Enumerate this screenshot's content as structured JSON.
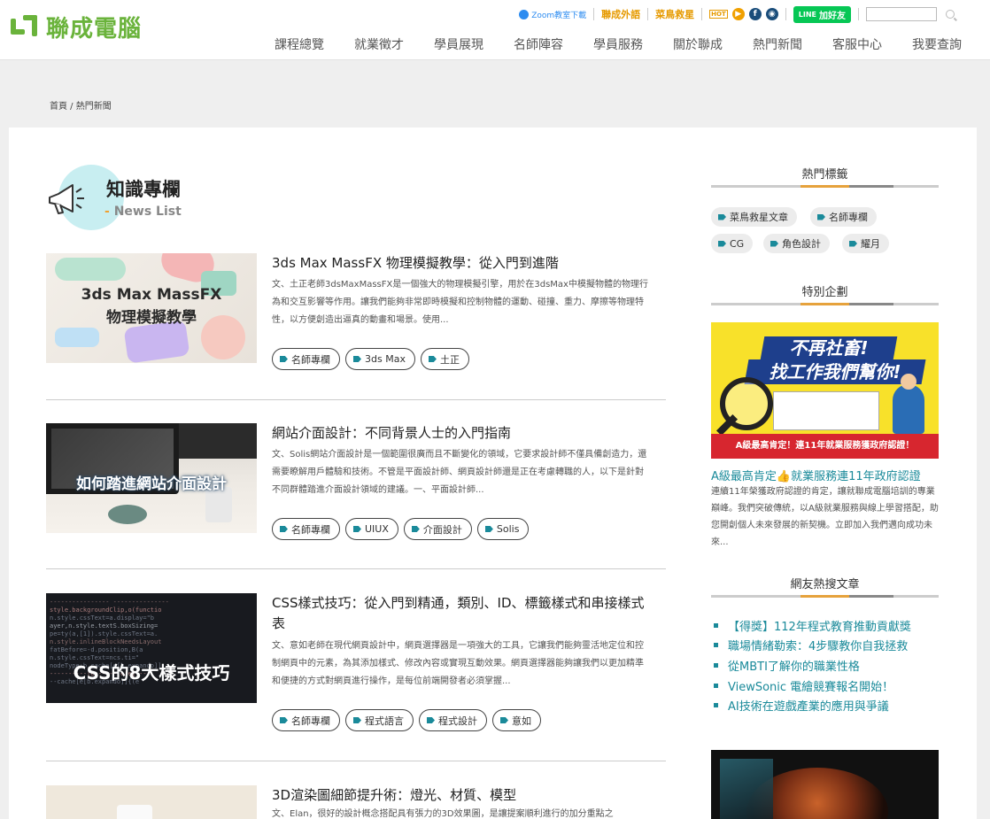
{
  "header": {
    "logo_text": "聯成電腦",
    "topbar": {
      "zoom": "Zoom教室下載",
      "lang": "聯成外語",
      "rescue": "菜鳥救星",
      "hot": "HOT",
      "line": "加好友",
      "search_placeholder": ""
    },
    "nav": [
      "課程總覽",
      "就業徵才",
      "學員展現",
      "名師陣容",
      "學員服務",
      "關於聯成",
      "熱門新聞",
      "客服中心",
      "我要查詢"
    ]
  },
  "breadcrumb": "首頁 / 熱門新聞",
  "section": {
    "title": "知識專欄",
    "subtitle_dash": "-",
    "subtitle": "News List"
  },
  "articles": [
    {
      "thumb_caption": [
        "3ds Max MassFX",
        "物理模擬教學"
      ],
      "title": "3ds Max MassFX 物理模擬教學：從入門到進階",
      "excerpt": "文、土正老師3dsMaxMassFX是一個強大的物理模擬引擎，用於在3dsMax中模擬物體的物理行為和交互影響等作用。讓我們能夠非常即時模擬和控制物體的運動、碰撞、重力、摩擦等物理特性，以方便創造出逼真的動畫和場景。使用...",
      "tags": [
        "名師專欄",
        "3ds Max",
        "土正"
      ]
    },
    {
      "thumb_caption": [
        "如何踏進網站介面設計"
      ],
      "title": "網站介面設計：不同背景人士的入門指南",
      "excerpt": "文、Solis網站介面設計是一個範圍很廣而且不斷變化的領域，它要求設計師不僅具備創造力，還需要瞭解用戶體驗和技術。不管是平面設計師、網頁設計師還是正在考慮轉職的人，以下是針對不同群體踏進介面設計領域的建議。一、平面設計師...",
      "tags": [
        "名師專欄",
        "UIUX",
        "介面設計",
        "Solis"
      ]
    },
    {
      "thumb_caption": [
        "CSS的8大樣式技巧"
      ],
      "title": "CSS樣式技巧：從入門到精通，類別、ID、標籤樣式和串接樣式表",
      "excerpt": "文、意如老師在現代網頁設計中，網頁選擇器是一項強大的工具，它讓我們能夠靈活地定位和控制網頁中的元素，為其添加樣式、修改內容或實現互動效果。網頁選擇器能夠讓我們以更加精準和便捷的方式對網頁進行操作，是每位前端開發者必須掌握...",
      "tags": [
        "名師專欄",
        "程式語言",
        "程式設計",
        "意如"
      ]
    },
    {
      "thumb_caption": [],
      "title": "3D渲染圖細節提升術：燈光、材質、模型",
      "excerpt": "文、Elan，很好的設計概念搭配具有張力的3D效果圖，是讓提案順利進行的加分重點之",
      "tags": []
    }
  ],
  "sidebar": {
    "popular_tags_title": "熱門標籤",
    "popular_tags": [
      "菜鳥救星文章",
      "名師專欄",
      "CG",
      "角色設計",
      "耀月"
    ],
    "special_title": "特別企劃",
    "promo_banner": {
      "headline1": "不再社畜!",
      "headline2": "找工作我們幫你!",
      "footer": "A級最高肯定！連11年就業服務獲政府認證！"
    },
    "promo_title": "A級最高肯定👍就業服務連11年政府認證",
    "promo_text": "連續11年榮獲政府認證的肯定，讓就聯成電腦培訓的專業巔峰。我們突破傳統，以A級就業服務與線上學習搭配，助您開創個人未來發展的新契機。立即加入我們邁向成功未來...",
    "hot_articles_title": "網友熱搜文章",
    "hot_articles": [
      "【得獎】112年程式教育推動貢獻獎",
      "職場情緒勒索：4步驟教你自我拯救",
      "從MBTI了解你的職業性格",
      "ViewSonic 電繪競賽報名開始！",
      "AI技術在遊戲產業的應用與爭議"
    ]
  },
  "colors": {
    "brand_green": "#6ab33b",
    "teal": "#1a8a9a",
    "orange": "#e69a00",
    "band_grey": "#efefef"
  }
}
